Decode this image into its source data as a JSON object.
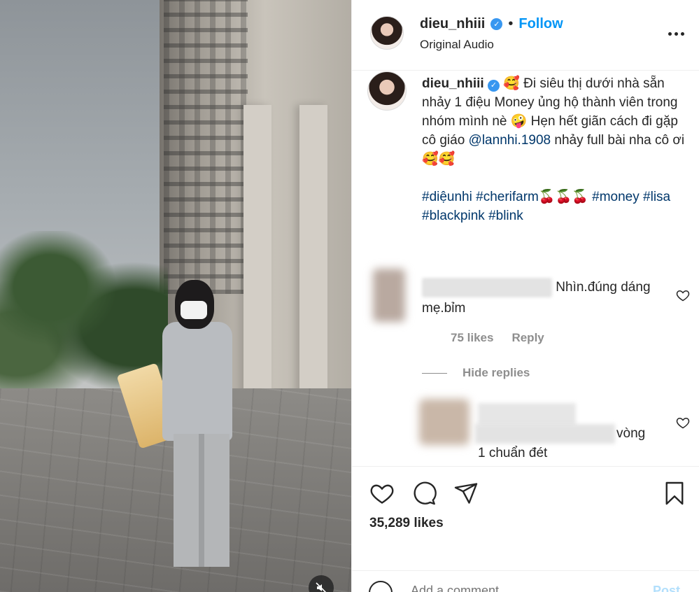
{
  "header": {
    "username": "dieu_nhiii",
    "separator": "•",
    "follow_label": "Follow",
    "subtitle": "Original Audio"
  },
  "caption": {
    "username": "dieu_nhiii",
    "text_part1": "🥰 Đi siêu thị dưới nhà sẵn nhảy 1 điệu Money ủng hộ thành viên trong nhóm mình nè 🤪 Hẹn hết giãn cách đi gặp cô giáo ",
    "mention": "@lannhi.1908",
    "text_part2": " nhảy full bài nha cô ơi 🥰🥰",
    "hashtag1": "#diệunhi",
    "hashtag2": "#cherifarm🍒🍒🍒",
    "hashtag3": "#money",
    "hashtag4": "#lisa",
    "hashtag5": "#blackpink",
    "hashtag6": "#blink"
  },
  "comment1": {
    "text": "Nhìn.đúng dáng mẹ.bỉm",
    "likes": "75 likes",
    "reply_label": "Reply"
  },
  "replies": {
    "hide_label": "Hide replies"
  },
  "comment2": {
    "text_line1": "vòng",
    "text_line2": "1 chuẩn đét"
  },
  "actions": {
    "likes_count": "35,289 likes"
  },
  "add_comment": {
    "placeholder": "Add a comment...",
    "post_label": "Post"
  },
  "icons": {
    "verified": "verified-badge-icon",
    "more": "more-options-icon",
    "heart": "heart-icon",
    "comment": "comment-icon",
    "share": "share-icon",
    "save": "bookmark-icon",
    "mute": "muted-speaker-icon",
    "emoji": "emoji-icon"
  },
  "colors": {
    "accent": "#0095f6",
    "verified": "#3897f0",
    "link": "#00376b",
    "secondary_text": "#8e8e8e"
  }
}
